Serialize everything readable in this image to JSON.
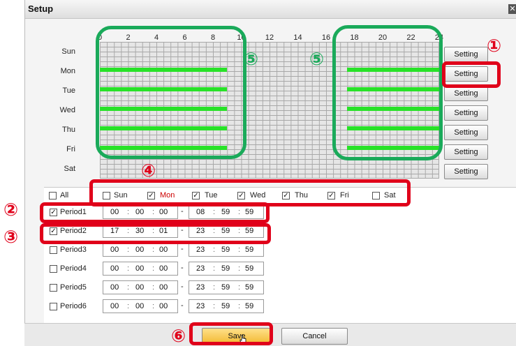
{
  "window": {
    "title": "Setup",
    "close_icon": "close-icon"
  },
  "timeline": {
    "hours": [
      "0",
      "2",
      "4",
      "6",
      "8",
      "10",
      "12",
      "14",
      "16",
      "18",
      "20",
      "22",
      "24"
    ],
    "days": [
      "Sun",
      "Mon",
      "Tue",
      "Wed",
      "Thu",
      "Fri",
      "Sat"
    ],
    "setting_label": "Setting",
    "schedule_bars": [
      {
        "day": "Mon",
        "start": 0,
        "end": 9
      },
      {
        "day": "Mon",
        "start": 17.5,
        "end": 24
      },
      {
        "day": "Tue",
        "start": 0,
        "end": 9
      },
      {
        "day": "Tue",
        "start": 17.5,
        "end": 24
      },
      {
        "day": "Wed",
        "start": 0,
        "end": 9
      },
      {
        "day": "Wed",
        "start": 17.5,
        "end": 24
      },
      {
        "day": "Thu",
        "start": 0,
        "end": 9
      },
      {
        "day": "Thu",
        "start": 17.5,
        "end": 24
      },
      {
        "day": "Fri",
        "start": 0,
        "end": 9
      },
      {
        "day": "Fri",
        "start": 17.5,
        "end": 24
      }
    ],
    "bar_color": "#28e228"
  },
  "day_checks": [
    {
      "label": "All",
      "checked": false
    },
    {
      "label": "Sun",
      "checked": false
    },
    {
      "label": "Mon",
      "checked": true,
      "color": "#cc0000"
    },
    {
      "label": "Tue",
      "checked": true
    },
    {
      "label": "Wed",
      "checked": true
    },
    {
      "label": "Thu",
      "checked": true
    },
    {
      "label": "Fri",
      "checked": true
    },
    {
      "label": "Sat",
      "checked": false
    }
  ],
  "periods": [
    {
      "label": "Period1",
      "checked": true,
      "start": [
        "00",
        "00",
        "00"
      ],
      "end": [
        "08",
        "59",
        "59"
      ]
    },
    {
      "label": "Period2",
      "checked": true,
      "start": [
        "17",
        "30",
        "01"
      ],
      "end": [
        "23",
        "59",
        "59"
      ]
    },
    {
      "label": "Period3",
      "checked": false,
      "start": [
        "00",
        "00",
        "00"
      ],
      "end": [
        "23",
        "59",
        "59"
      ]
    },
    {
      "label": "Period4",
      "checked": false,
      "start": [
        "00",
        "00",
        "00"
      ],
      "end": [
        "23",
        "59",
        "59"
      ]
    },
    {
      "label": "Period5",
      "checked": false,
      "start": [
        "00",
        "00",
        "00"
      ],
      "end": [
        "23",
        "59",
        "59"
      ]
    },
    {
      "label": "Period6",
      "checked": false,
      "start": [
        "00",
        "00",
        "00"
      ],
      "end": [
        "23",
        "59",
        "59"
      ]
    }
  ],
  "time_sep": ":",
  "range_sep": "-",
  "buttons": {
    "save": "Save",
    "cancel": "Cancel"
  },
  "annotations": {
    "n1": "①",
    "n2": "②",
    "n3": "③",
    "n4": "④",
    "n5": "⑤",
    "n6": "⑥"
  },
  "colors": {
    "annotation_red": "#e0001a",
    "annotation_green": "#1aaa5a",
    "save_button": "#f7c84a"
  }
}
